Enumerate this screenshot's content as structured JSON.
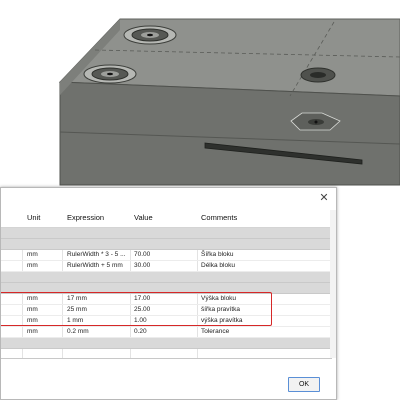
{
  "table": {
    "headers": {
      "unit": "Unit",
      "expression": "Expression",
      "value": "Value",
      "comments": "Comments"
    },
    "rows": [
      {
        "unit": "mm",
        "expression": "RulerWidth * 3 - 5 ...",
        "value": "70.00",
        "comments": "Šířka bloku"
      },
      {
        "unit": "mm",
        "expression": "RulerWidth + 5 mm",
        "value": "30.00",
        "comments": "Délka bloku"
      },
      {
        "unit": "mm",
        "expression": "17 mm",
        "value": "17.00",
        "comments": "Výška bloku"
      },
      {
        "unit": "mm",
        "expression": "25 mm",
        "value": "25.00",
        "comments": "šířka pravítka"
      },
      {
        "unit": "mm",
        "expression": "1 mm",
        "value": "1.00",
        "comments": "výška pravítka"
      },
      {
        "unit": "mm",
        "expression": "0.2 mm",
        "value": "0.20",
        "comments": "Tolerance"
      }
    ]
  },
  "dialog": {
    "close_glyph": "✕",
    "ok_label": "OK"
  },
  "colors": {
    "model_top": "#8f918d",
    "model_front": "#6f716d",
    "highlight": "#d62828",
    "ok_border": "#5a8fd6"
  }
}
